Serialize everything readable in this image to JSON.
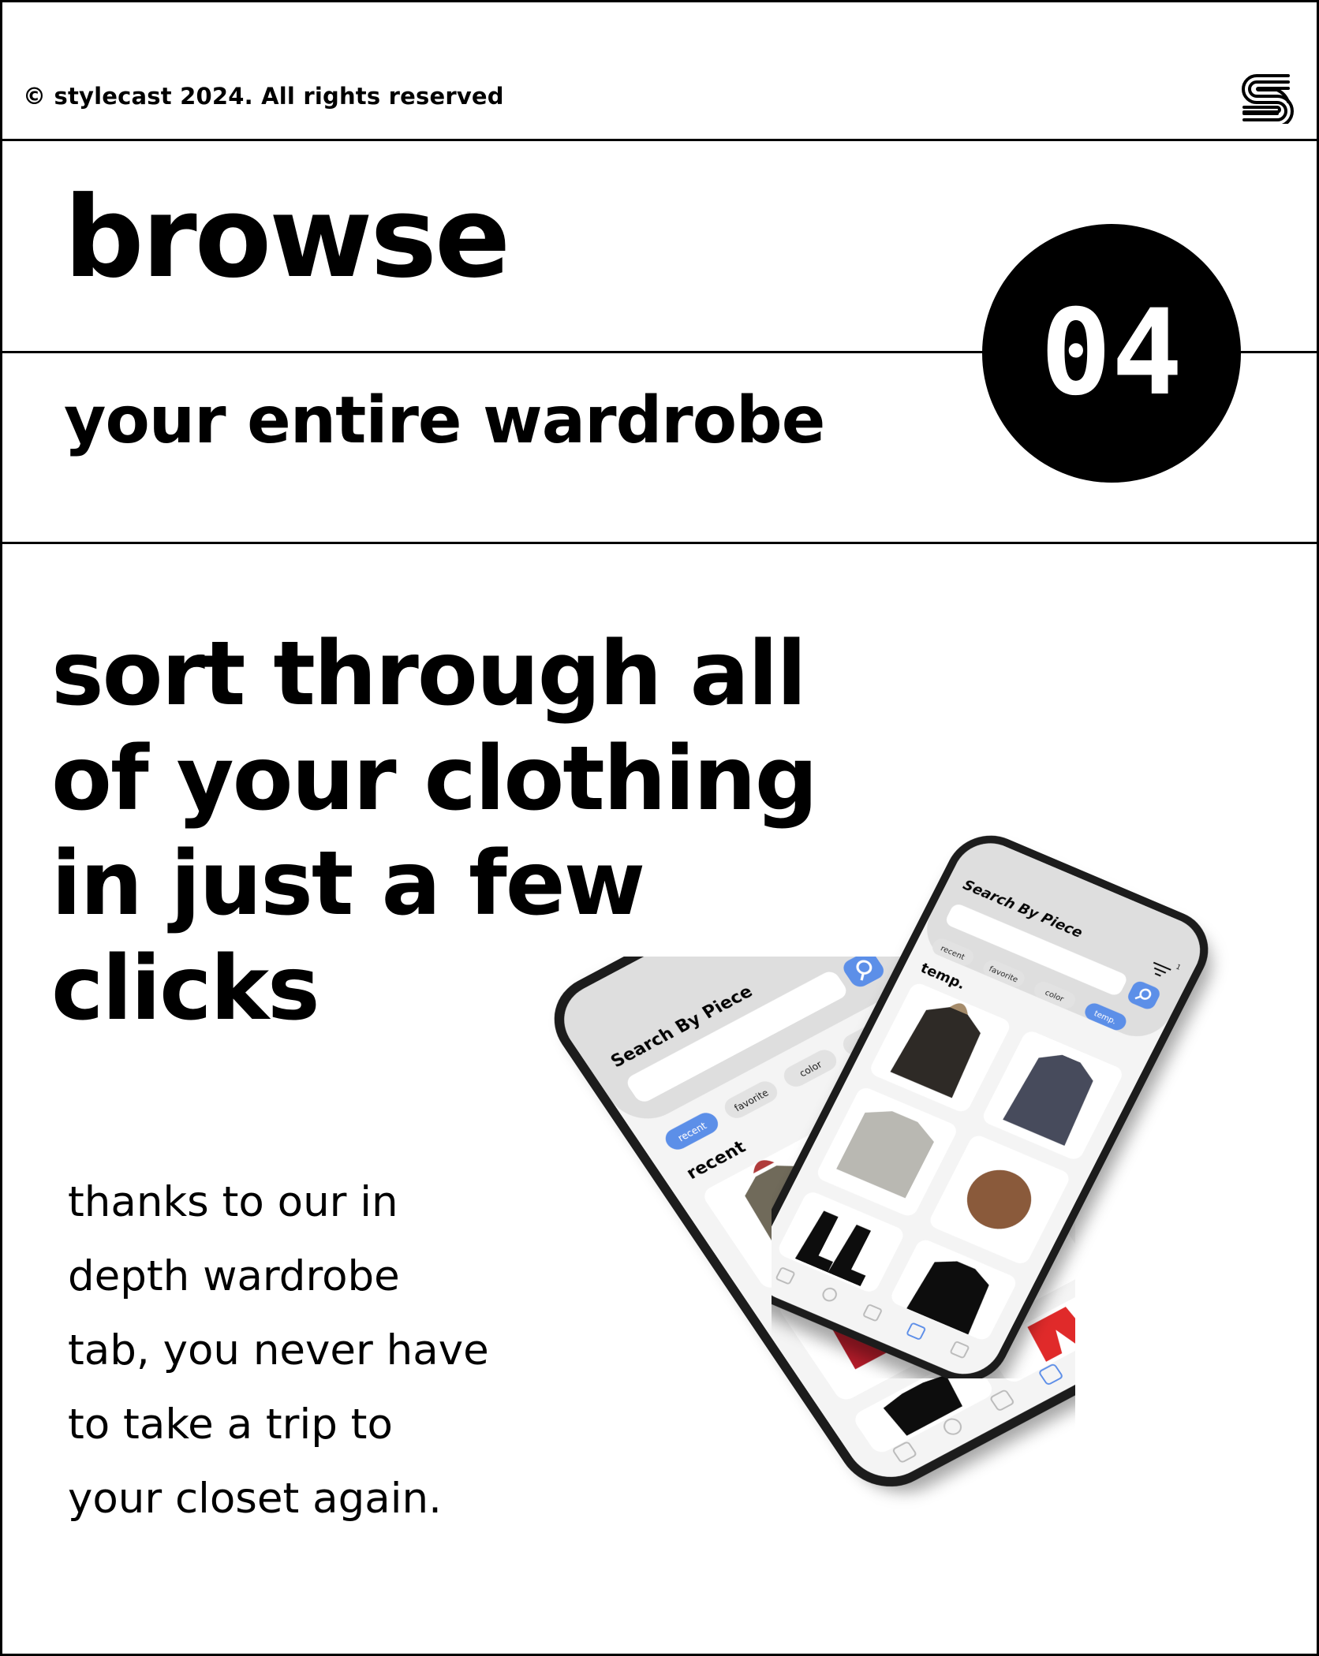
{
  "header": {
    "copyright": "© stylecast 2024. All rights reserved",
    "logo_icon": "stylecast-logo-icon"
  },
  "hero": {
    "title": "browse",
    "subtitle": "your entire wardrobe",
    "step_number": "04"
  },
  "content": {
    "headline_lines": [
      "sort through all",
      "of your clothing",
      "in just a few",
      "clicks"
    ],
    "body_lines": [
      "thanks to our in",
      "depth wardrobe",
      "tab, you never have",
      "to take a trip to",
      "your closet again."
    ]
  },
  "phones": {
    "back_phone": {
      "title": "Search By Piece",
      "filter_count": "1",
      "filters": [
        "recent",
        "favorite",
        "color",
        "temp"
      ],
      "active_filter": "recent",
      "section_label": "recent"
    },
    "front_phone": {
      "title": "Search By Piece",
      "filter_count": "1",
      "filters": [
        "recent",
        "favorite",
        "color",
        "temp."
      ],
      "active_filter": "temp.",
      "section_label": "temp."
    },
    "nav_icons": [
      "home-icon",
      "search-icon",
      "add-icon",
      "wardrobe-icon",
      "profile-icon"
    ]
  },
  "colors": {
    "accent": "#5b8fe8",
    "phone_frame": "#1a1a1a",
    "tag_bg": "#e2e2e2"
  }
}
